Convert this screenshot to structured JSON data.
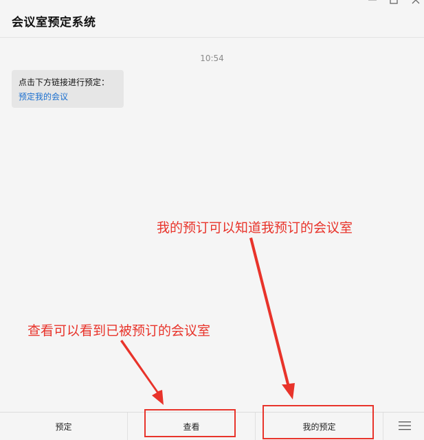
{
  "window": {
    "title": "会议室预定系统"
  },
  "chat": {
    "timestamp": "10:54",
    "message": {
      "text": "点击下方链接进行预定：",
      "link": "预定我的会议"
    }
  },
  "annotations": {
    "top": "我的预订可以知道我预订的会议室",
    "left": "查看可以看到已被预订的会议室",
    "color": "#e8332a"
  },
  "bottom_menu": {
    "items": [
      {
        "label": "预定"
      },
      {
        "label": "查看"
      },
      {
        "label": "我的预定"
      }
    ],
    "menu_icon": "hamburger-icon"
  }
}
